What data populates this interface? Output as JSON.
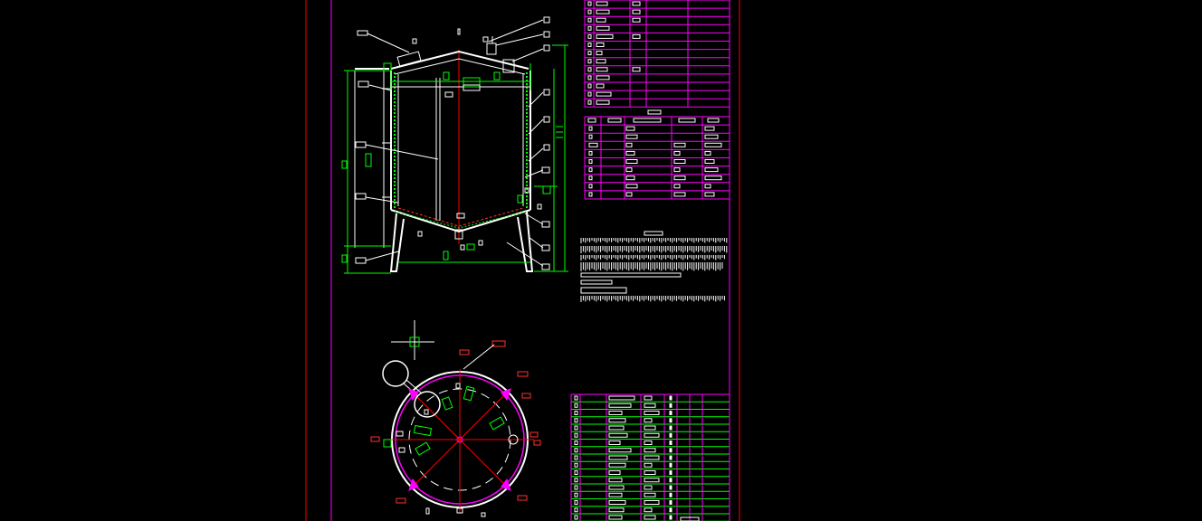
{
  "colors": {
    "background": "#000000",
    "frame": "#ff0000",
    "border": "#ff00ff",
    "table": "#ff00ff",
    "dimension": "#00ff00",
    "geometry": "#ffffff",
    "centerline": "#ff0000",
    "label_box": "#ffffff",
    "accent_label": "#ff3030"
  },
  "views": {
    "elevation": {
      "name": "tank-elevation-view",
      "label_boxes": 28
    },
    "plan": {
      "name": "tank-plan-view",
      "label_boxes": 9,
      "support_legs": 4
    }
  },
  "tables": {
    "parts_list_top": {
      "rows": 13,
      "columns": 5
    },
    "design_data": {
      "rows": 10,
      "columns": 5
    },
    "bill_of_materials": {
      "rows": 17,
      "columns": 7
    }
  },
  "technical_notes": {
    "lines": 8
  }
}
